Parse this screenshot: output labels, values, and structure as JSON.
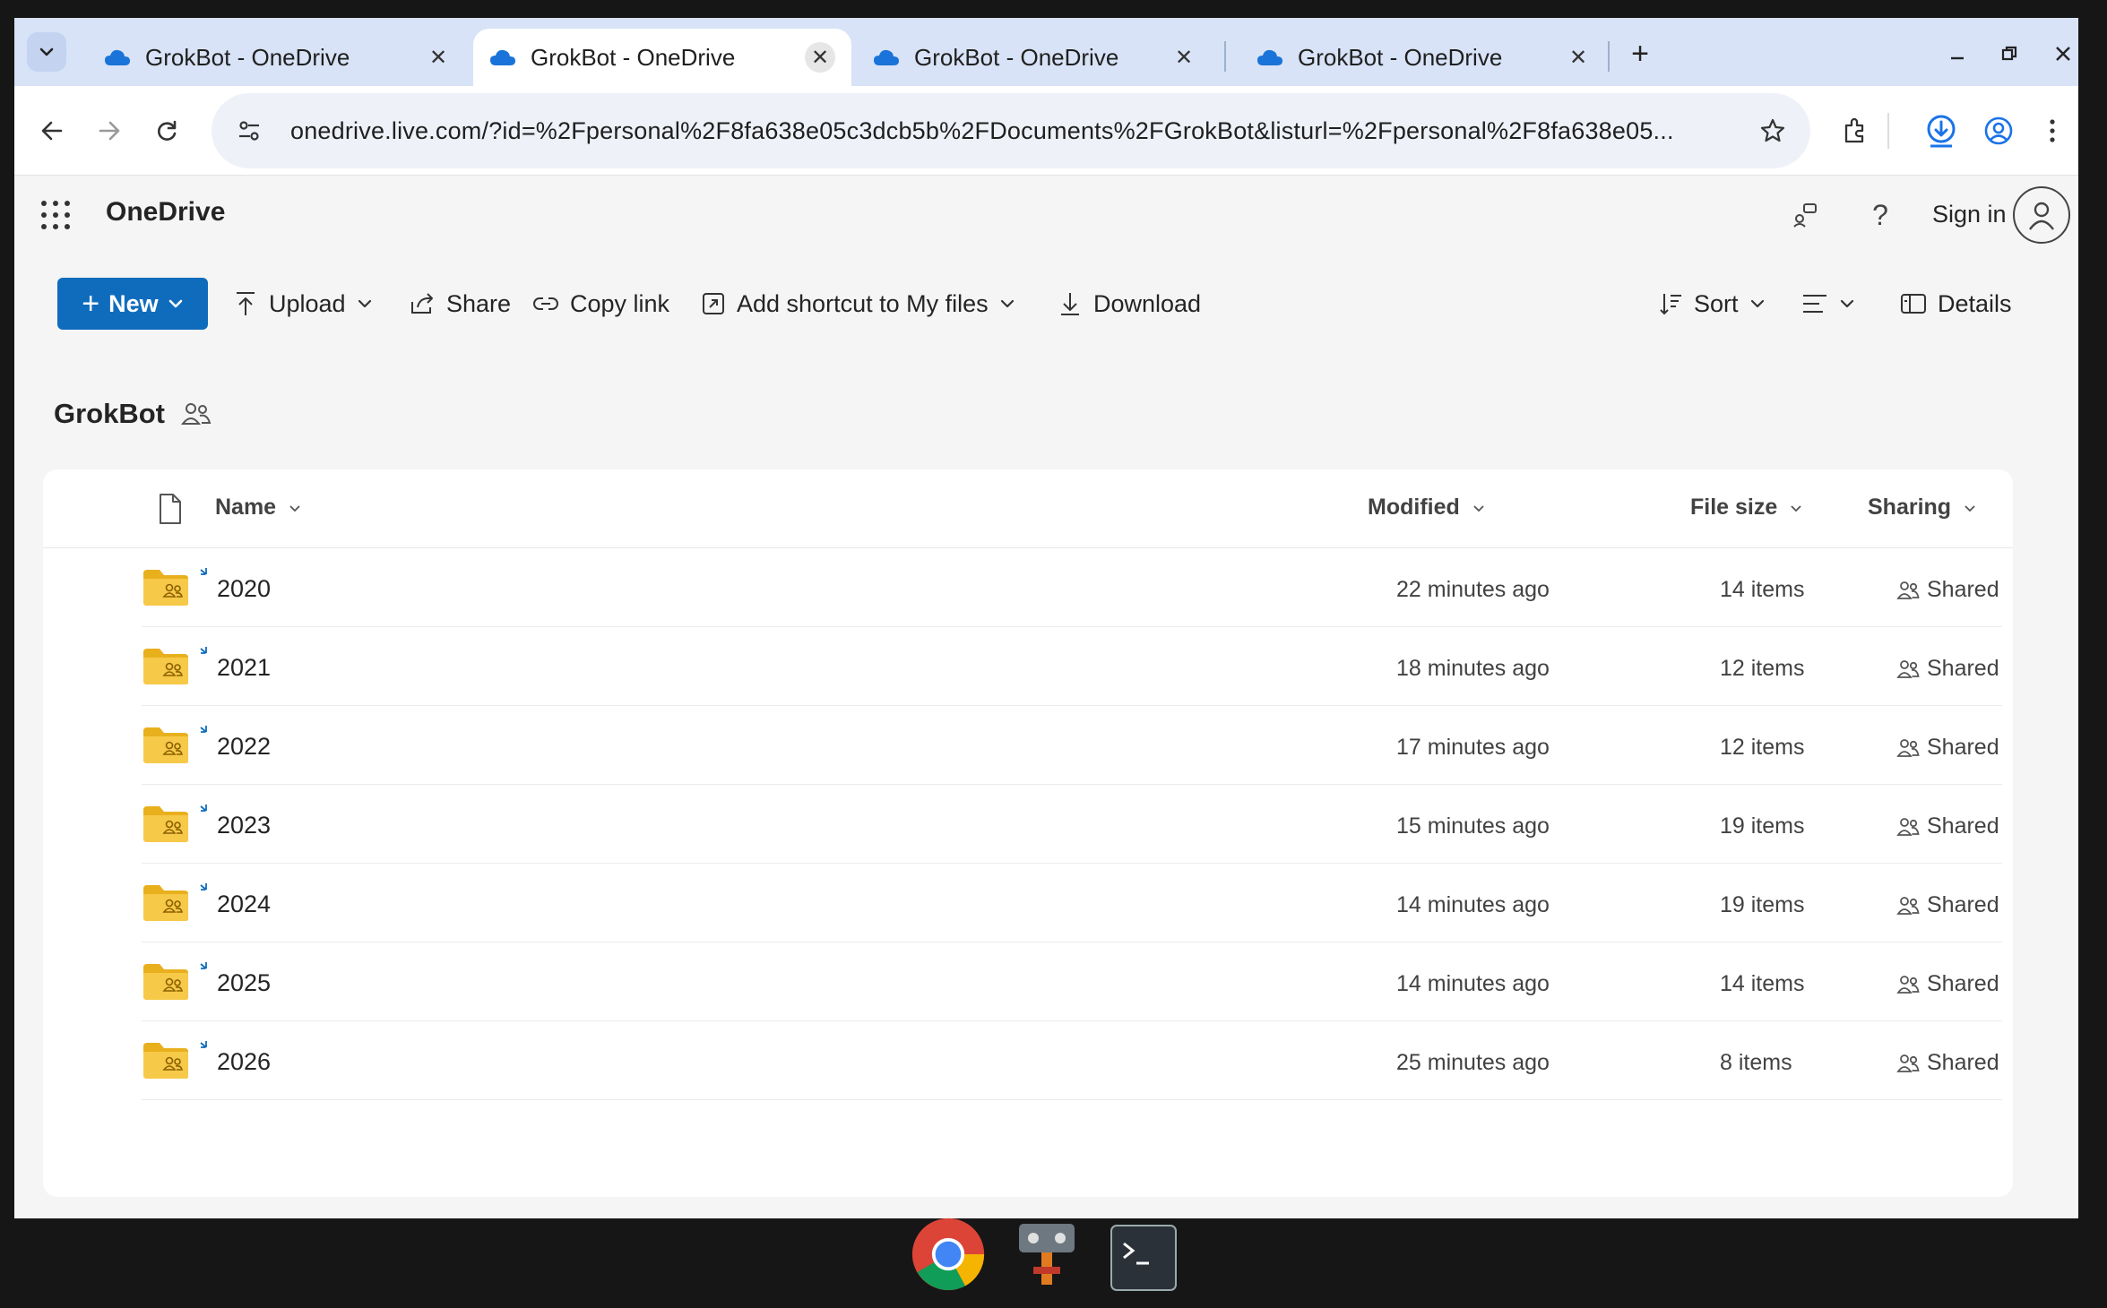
{
  "browser": {
    "tabs": [
      {
        "label": "GrokBot - OneDrive",
        "active": false
      },
      {
        "label": "GrokBot - OneDrive",
        "active": true
      },
      {
        "label": "GrokBot - OneDrive",
        "active": false
      },
      {
        "label": "GrokBot - OneDrive",
        "active": false
      }
    ],
    "url": "onedrive.live.com/?id=%2Fpersonal%2F8fa638e05c3dcb5b%2FDocuments%2FGrokBot&listurl=%2Fpersonal%2F8fa638e05..."
  },
  "header": {
    "brand": "OneDrive",
    "signin_label": "Sign in"
  },
  "commands": {
    "new_label": "New",
    "upload_label": "Upload",
    "share_label": "Share",
    "copy_link_label": "Copy link",
    "add_shortcut_label": "Add shortcut to My files",
    "download_label": "Download",
    "sort_label": "Sort",
    "details_label": "Details"
  },
  "folder": {
    "title": "GrokBot"
  },
  "list": {
    "columns": {
      "name": "Name",
      "modified": "Modified",
      "size": "File size",
      "sharing": "Sharing"
    },
    "rows": [
      {
        "name": "2020",
        "modified": "22 minutes ago",
        "size": "14 items",
        "sharing": "Shared"
      },
      {
        "name": "2021",
        "modified": "18 minutes ago",
        "size": "12 items",
        "sharing": "Shared"
      },
      {
        "name": "2022",
        "modified": "17 minutes ago",
        "size": "12 items",
        "sharing": "Shared"
      },
      {
        "name": "2023",
        "modified": "15 minutes ago",
        "size": "19 items",
        "sharing": "Shared"
      },
      {
        "name": "2024",
        "modified": "14 minutes ago",
        "size": "19 items",
        "sharing": "Shared"
      },
      {
        "name": "2025",
        "modified": "14 minutes ago",
        "size": "14 items",
        "sharing": "Shared"
      },
      {
        "name": "2026",
        "modified": "25 minutes ago",
        "size": "8 items",
        "sharing": "Shared"
      }
    ]
  },
  "colors": {
    "accent": "#0f6cbd",
    "folder": "#f7c948"
  }
}
